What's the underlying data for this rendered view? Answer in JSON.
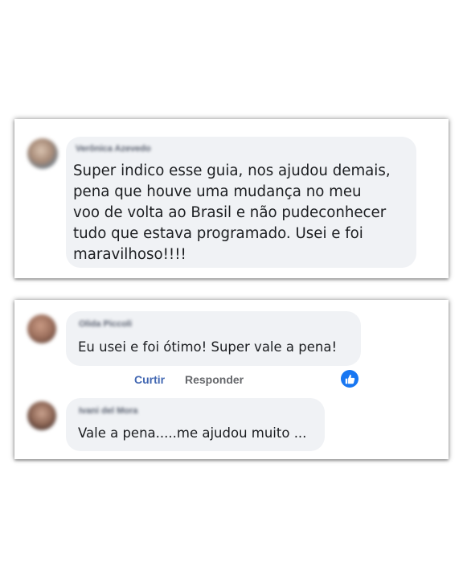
{
  "colors": {
    "link_blue": "#4267b2",
    "action_gray": "#65676b",
    "bubble_bg": "#f0f2f5",
    "reaction_blue": "#1877f2"
  },
  "post_comment": {
    "author": "Verônica Azevedo",
    "text": "Super indico esse guia, nos ajudou demais,\npena que houve uma mudança no meu\nvoo de volta ao Brasil e não pudeconhecer\ntudo que estava programado. Usei e foi\nmaravilhoso!!!!"
  },
  "thread": {
    "comments": [
      {
        "author": "Olida Piccoli",
        "text": "Eu usei e foi ótimo! Super vale a pena!",
        "actions": {
          "like_label": "Curtir",
          "reply_label": "Responder"
        },
        "reaction_icon": "like-thumb-icon"
      },
      {
        "author": "Ivani del Mora",
        "text": "Vale a pena.....me ajudou muito ..."
      }
    ]
  }
}
